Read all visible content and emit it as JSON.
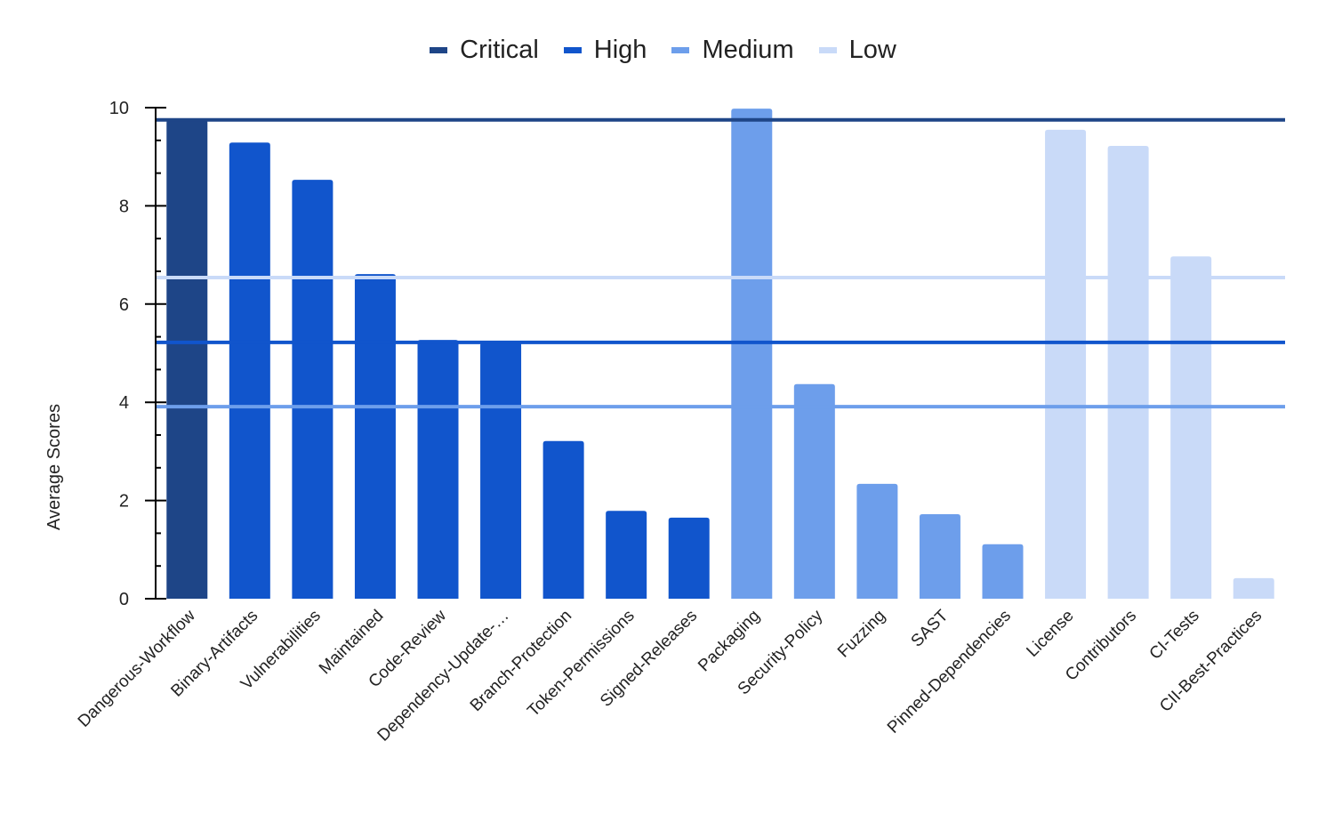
{
  "chart_data": {
    "type": "bar",
    "title": "",
    "xlabel": "",
    "ylabel": "Average Scores",
    "ylim": [
      0,
      10
    ],
    "yticks": [
      0,
      2,
      4,
      6,
      8,
      10
    ],
    "grid": false,
    "legend_position": "top",
    "legend": [
      {
        "name": "Critical",
        "color": "#1e4587"
      },
      {
        "name": "High",
        "color": "#1155cc"
      },
      {
        "name": "Medium",
        "color": "#6d9eeb"
      },
      {
        "name": "Low",
        "color": "#c9daf8"
      }
    ],
    "categories": [
      "Dangerous-Workflow",
      "Binary-Artifacts",
      "Vulnerabilities",
      "Maintained",
      "Code-Review",
      "Dependency-Update-…",
      "Branch-Protection",
      "Token-Permissions",
      "Signed-Releases",
      "Packaging",
      "Security-Policy",
      "Fuzzing",
      "SAST",
      "Pinned-Dependencies",
      "License",
      "Contributors",
      "CI-Tests",
      "CII-Best-Practices"
    ],
    "risk": [
      "Critical",
      "High",
      "High",
      "High",
      "High",
      "High",
      "High",
      "High",
      "High",
      "Medium",
      "Medium",
      "Medium",
      "Medium",
      "Medium",
      "Low",
      "Low",
      "Low",
      "Low"
    ],
    "values": [
      9.75,
      9.29,
      8.53,
      6.61,
      5.27,
      5.22,
      3.21,
      1.79,
      1.65,
      9.98,
      4.37,
      2.34,
      1.72,
      1.11,
      9.55,
      9.22,
      6.97,
      0.42
    ],
    "reference_lines": [
      {
        "name": "Critical average",
        "risk": "Critical",
        "value": 9.75
      },
      {
        "name": "Low average",
        "risk": "Low",
        "value": 6.54
      },
      {
        "name": "High average",
        "risk": "High",
        "value": 5.22
      },
      {
        "name": "Medium average",
        "risk": "Medium",
        "value": 3.91
      }
    ]
  }
}
